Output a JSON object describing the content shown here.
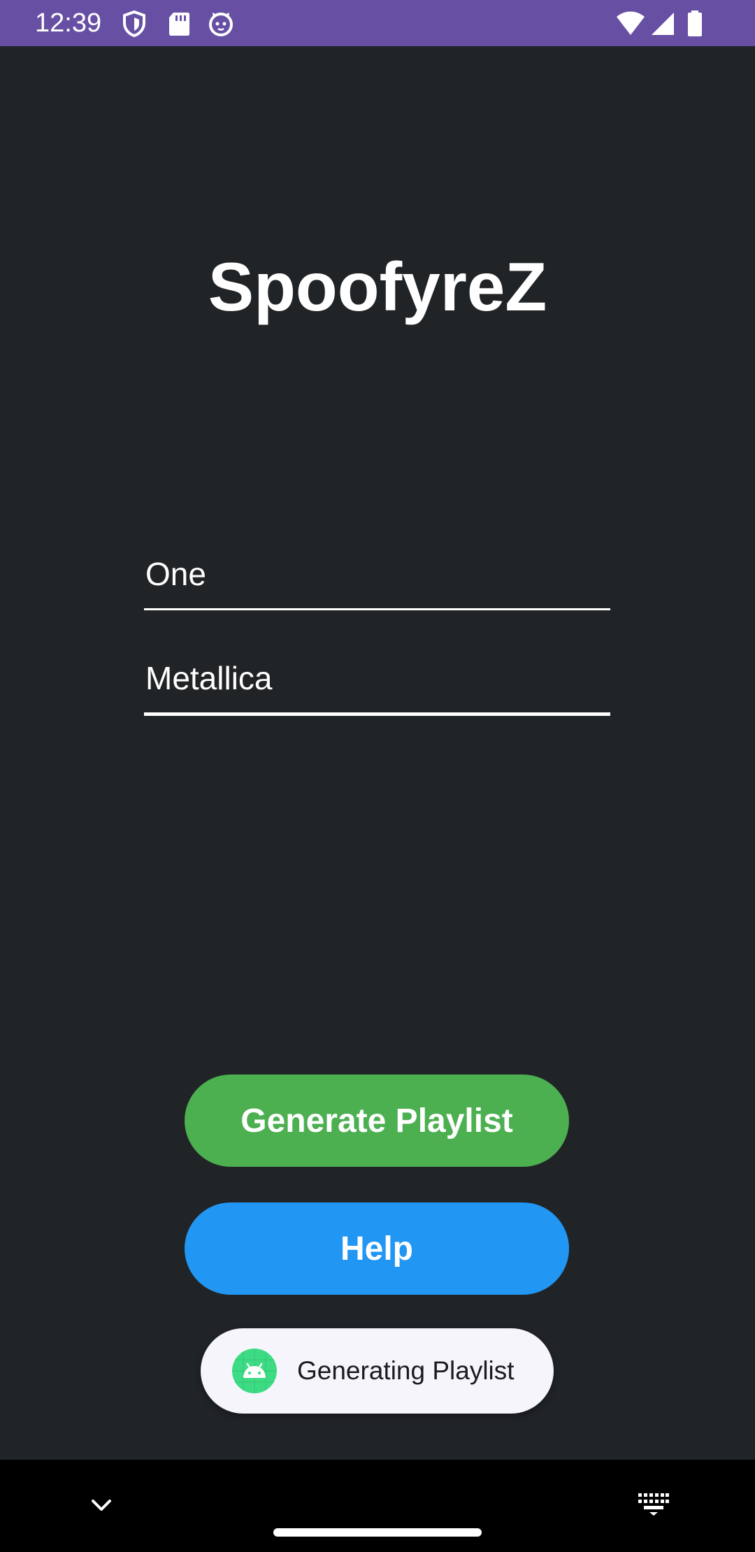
{
  "status_bar": {
    "time": "12:39",
    "color": "#6750a4",
    "left_icons": [
      "shield-icon",
      "sd-card-icon",
      "cat-face-icon"
    ],
    "right_icons": [
      "wifi-icon",
      "signal-icon",
      "battery-icon"
    ]
  },
  "app": {
    "title": "SpoofyreZ",
    "background": "#212427"
  },
  "form": {
    "song_value": "One",
    "artist_value": "Metallica"
  },
  "buttons": {
    "generate_label": "Generate Playlist",
    "generate_color": "#4caf50",
    "help_label": "Help",
    "help_color": "#2196f3"
  },
  "toast": {
    "icon": "android-icon",
    "message": "Generating Playlist"
  },
  "nav_bar": {
    "icons": [
      "chevron-down-icon",
      "home-handle",
      "keyboard-icon"
    ]
  }
}
